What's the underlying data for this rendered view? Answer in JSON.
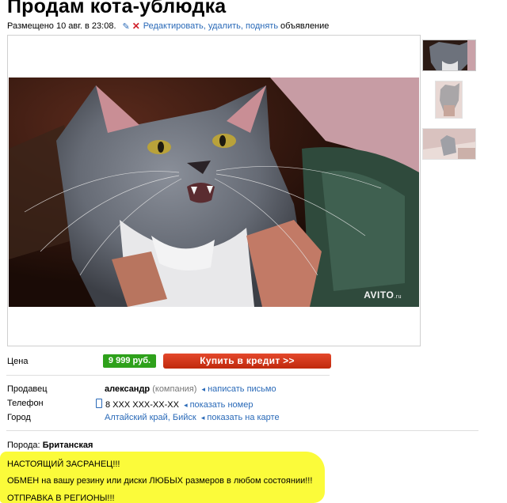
{
  "ad": {
    "title": "Продам кота-ублюдка",
    "posted": "Размещено 10 авг. в 23:08.",
    "edit_link": "Редактировать, удалить, поднять",
    "edit_suffix": "объявление"
  },
  "photo": {
    "watermark": "AVITO",
    "watermark_suffix": ".ru"
  },
  "thumbnails": [
    "cat-photo-1",
    "cat-photo-2",
    "cat-photo-3"
  ],
  "price": {
    "label": "Цена",
    "value": "9 999 руб.",
    "credit_button": "Купить в кредит >>"
  },
  "contacts": {
    "seller_label": "Продавец",
    "seller_name": "александр",
    "seller_type": "(компания)",
    "write_link": "написать письмо",
    "phone_label": "Телефон",
    "phone": "8 XXX XXX-XX-XX",
    "show_phone": "показать номер",
    "city_label": "Город",
    "city": "Алтайский край, Бийск",
    "map_link": "показать на карте"
  },
  "description": {
    "breed_label": "Порода:",
    "breed": "Британская",
    "lines": [
      "НАСТОЯЩИЙ ЗАСРАНЕЦ!!!",
      "ОБМЕН на вашу резину или диски ЛЮБЫХ размеров в любом состоянии!!!",
      "ОТПРАВКА В РЕГИОНЫ!!!"
    ]
  },
  "colors": {
    "link": "#2a6ab8",
    "price_bg": "#2ea11b",
    "credit_bg": "#d23818",
    "highlight": "#fbfb3a"
  }
}
